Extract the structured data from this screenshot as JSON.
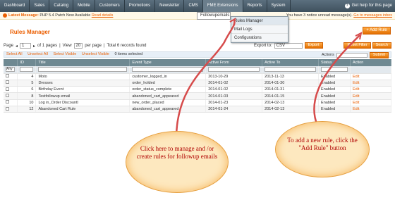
{
  "nav": [
    "Dashboard",
    "Sales",
    "Catalog",
    "Mobile",
    "Customers",
    "Promotions",
    "Newsletter",
    "CMS",
    "FME Extensions",
    "Reports",
    "System"
  ],
  "help": "Get help for this page",
  "msg": {
    "label": "Latest Message:",
    "text": "PHP 5.4 Patch Now Available",
    "link": "Read details",
    "right": "You have 3 notice unread message(s).",
    "right_link": "Go to messages inbox"
  },
  "menu": {
    "parent": "Followupemails",
    "items": [
      "Rules Manager",
      "Mail Logs",
      "Configurations"
    ]
  },
  "title": "Rules Manager",
  "add_rule": "Add Rule",
  "pager": {
    "page_label": "Page",
    "page": "1",
    "of": "of 1 pages",
    "view": "View",
    "per": "20",
    "per_page": "per page",
    "total": "Total 6 records found"
  },
  "export": {
    "label": "Export to:",
    "format": "CSV",
    "button": "Export"
  },
  "reset": "Reset Filter",
  "search": "Search",
  "select": {
    "all": "Select All",
    "unall": "Unselect All",
    "vis": "Select Visible",
    "unvis": "Unselect Visible",
    "count": "0 items selected",
    "actions": "Actions",
    "submit": "Submit"
  },
  "filter_any": "Any",
  "cols": [
    "",
    "ID",
    "Title",
    "Event Type",
    "Active From",
    "Active To",
    "Status",
    "Action"
  ],
  "rows": [
    [
      "4",
      "Moto",
      "customer_logged_in",
      "2013-10-29",
      "2013-11-13",
      "Enabled",
      "Edit"
    ],
    [
      "5",
      "Dresses",
      "order_holded",
      "2014-01-02",
      "2014-01-30",
      "Enabled",
      "Edit"
    ],
    [
      "6",
      "Birthday Event",
      "order_status_complete",
      "2014-01-02",
      "2014-01-31",
      "Enabled",
      "Edit"
    ],
    [
      "8",
      "Testfollowup email",
      "abandoned_cart_appeared",
      "2014-01-03",
      "2014-01-15",
      "Enabled",
      "Edit"
    ],
    [
      "10",
      "Log in_Order Discountl",
      "new_order_placed",
      "2014-01-23",
      "2014-02-13",
      "Enabled",
      "Edit"
    ],
    [
      "12",
      "Abandoned Cart Rule",
      "abandoned_cart_appeared",
      "2014-01-24",
      "2014-02-13",
      "Enabled",
      "Edit"
    ]
  ],
  "callout1": "Click here to manage and /or create rules for followup emails",
  "callout2": "To add a new rule, click the \"Add Rule\" button",
  "colors": {
    "accent": "#eb5e00",
    "header": "#6f8992",
    "callout": "#b00000"
  }
}
